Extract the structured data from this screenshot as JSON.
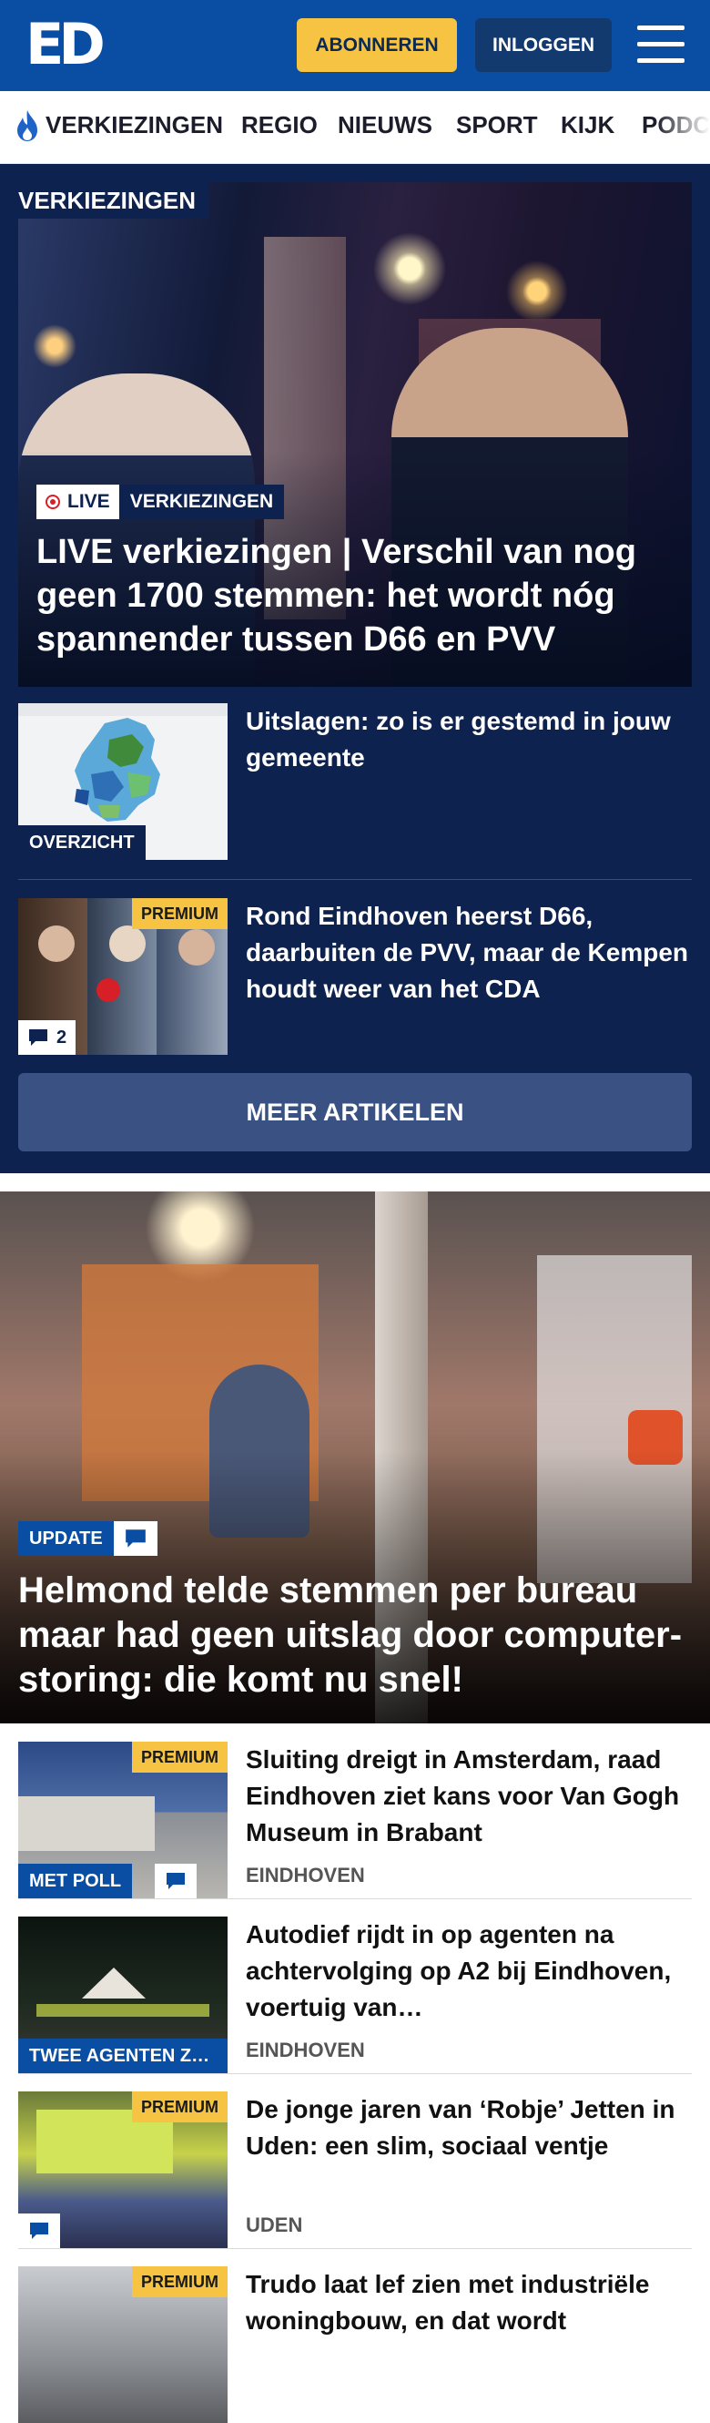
{
  "header": {
    "logo_text": "ED",
    "subscribe_label": "ABONNEREN",
    "login_label": "INLOGGEN",
    "menu_icon": "hamburger-icon",
    "brand_color": "#0a4ea3",
    "accent_color": "#f6c343"
  },
  "nav": {
    "items": [
      "VERKIEZINGEN",
      "REGIO",
      "NIEUWS",
      "SPORT",
      "KIJK",
      "PODCAST"
    ],
    "first_icon": "flame-icon"
  },
  "election": {
    "section_label": "VERKIEZINGEN",
    "hero": {
      "live_label": "LIVE",
      "category": "VERKIEZINGEN",
      "title": "LIVE verkiezingen | Verschil van nog geen 1700 stemmen: het wordt nóg spannender tussen D66 en PVV"
    },
    "articles": [
      {
        "title": "Uitslagen: zo is er gestemd in jouw gemeente",
        "tag": "OVERZICHT"
      },
      {
        "title": "Rond Eindhoven heerst D66, daarbuiten de PVV, maar de Kempen houdt weer van het CDA",
        "premium": "PREMIUM",
        "comments": "2"
      }
    ],
    "more_label": "MEER ARTIKELEN"
  },
  "featured": {
    "tag": "UPDATE",
    "title": "Helmond telde stemmen per bureau maar had geen uitslag door computer­storing: die komt nu snel!"
  },
  "articles": [
    {
      "title": "Sluiting dreigt in Amsterdam, raad Eindhoven ziet kans voor Van Gogh Museum in Brabant",
      "location": "EINDHOVEN",
      "premium": "PREMIUM",
      "tag": "MET POLL"
    },
    {
      "title": "Autodief rijdt in op agenten na achtervolging op A2 bij Eindhoven, voertuig van…",
      "location": "EINDHOVEN",
      "tag": "TWEE AGENTEN Z…"
    },
    {
      "title": "De jonge jaren van ‘Robje’ Jetten in Uden: een slim, sociaal ventje",
      "location": "UDEN",
      "premium": "PREMIUM"
    },
    {
      "title": "Trudo laat lef zien met indu­striële woningbouw, en dat wordt",
      "premium": "PREMIUM"
    }
  ]
}
